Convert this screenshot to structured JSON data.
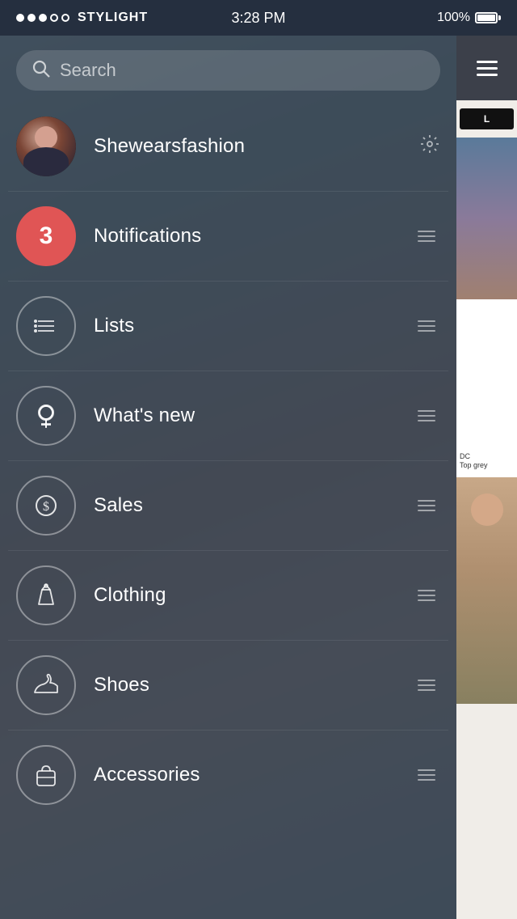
{
  "statusBar": {
    "carrier": "STYLIGHT",
    "dots": [
      true,
      true,
      true,
      false,
      false
    ],
    "time": "3:28 PM",
    "battery": "100%"
  },
  "search": {
    "placeholder": "Search"
  },
  "menu": {
    "items": [
      {
        "id": "profile",
        "label": "Shewearsfashion",
        "iconType": "avatar",
        "hasSettings": true,
        "hasDrag": false
      },
      {
        "id": "notifications",
        "label": "Notifications",
        "iconType": "number",
        "iconValue": "3",
        "hasSettings": false,
        "hasDrag": true
      },
      {
        "id": "lists",
        "label": "Lists",
        "iconType": "list",
        "hasSettings": false,
        "hasDrag": true
      },
      {
        "id": "whatsnew",
        "label": "What's new",
        "iconType": "female",
        "hasSettings": false,
        "hasDrag": true
      },
      {
        "id": "sales",
        "label": "Sales",
        "iconType": "dollar",
        "hasSettings": false,
        "hasDrag": true
      },
      {
        "id": "clothing",
        "label": "Clothing",
        "iconType": "dress",
        "hasSettings": false,
        "hasDrag": true
      },
      {
        "id": "shoes",
        "label": "Shoes",
        "iconType": "shoe",
        "hasSettings": false,
        "hasDrag": true
      },
      {
        "id": "accessories",
        "label": "Accessories",
        "iconType": "bag",
        "hasSettings": false,
        "hasDrag": true
      }
    ]
  },
  "rightPanel": {
    "brandLabel": "L",
    "dc_title": "DC",
    "dc_sub": "Top grey"
  }
}
